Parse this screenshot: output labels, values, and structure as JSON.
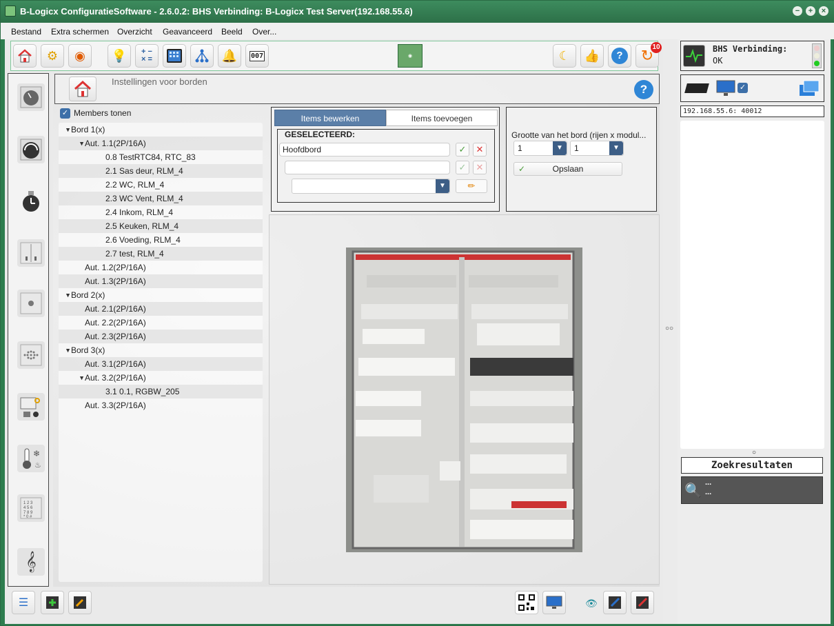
{
  "window": {
    "title": "B-Logicx ConfiguratieSoftware - 2.6.0.2: BHS Verbinding: B-Logicx Test Server(192.168.55.6)",
    "controls": [
      "−",
      "+",
      "×"
    ]
  },
  "menu": [
    "Bestand",
    "Extra schermen",
    "Overzicht",
    "Geavanceerd",
    "Beeld",
    "Over..."
  ],
  "toolbar": {
    "left_icons": [
      "home-icon",
      "wrench-icon",
      "gear-person-icon",
      "lightbulb-gear-icon",
      "calculator-icon",
      "tablet-icon",
      "network-icon",
      "bell-icon",
      "counter-icon"
    ],
    "logo_alt": "logo",
    "right_icons": [
      "moon-icon",
      "thumbs-up-icon",
      "help-icon",
      "refresh-icon"
    ],
    "notification_count": "10"
  },
  "left_rail": [
    "thermostat-icon",
    "gauge-icon",
    "clock-icon",
    "switch-icon",
    "button-icon",
    "speaker-icon",
    "sensor-icon",
    "thermometer-icon",
    "keypad-icon",
    "music-icon"
  ],
  "header": {
    "title": "Instellingen voor borden",
    "help": "?"
  },
  "members_toggle": {
    "label": "Members tonen",
    "checked": true
  },
  "tree": [
    {
      "label": "Bord 1(x)",
      "level": 0,
      "toggle": "▲"
    },
    {
      "label": "Aut. 1.1(2P/16A)",
      "level": 1,
      "toggle": "▲"
    },
    {
      "label": "0.8 TestRTC84, RTC_83",
      "level": 2,
      "toggle": ""
    },
    {
      "label": "2.1 Sas deur, RLM_4",
      "level": 2,
      "toggle": ""
    },
    {
      "label": "2.2 WC, RLM_4",
      "level": 2,
      "toggle": ""
    },
    {
      "label": "2.3 WC Vent, RLM_4",
      "level": 2,
      "toggle": ""
    },
    {
      "label": "2.4 Inkom, RLM_4",
      "level": 2,
      "toggle": ""
    },
    {
      "label": "2.5 Keuken, RLM_4",
      "level": 2,
      "toggle": ""
    },
    {
      "label": "2.6 Voeding, RLM_4",
      "level": 2,
      "toggle": ""
    },
    {
      "label": "2.7 test, RLM_4",
      "level": 2,
      "toggle": ""
    },
    {
      "label": "Aut. 1.2(2P/16A)",
      "level": 1,
      "toggle": ""
    },
    {
      "label": "Aut. 1.3(2P/16A)",
      "level": 1,
      "toggle": ""
    },
    {
      "label": "Bord 2(x)",
      "level": 0,
      "toggle": "▲"
    },
    {
      "label": "Aut. 2.1(2P/16A)",
      "level": 1,
      "toggle": ""
    },
    {
      "label": "Aut. 2.2(2P/16A)",
      "level": 1,
      "toggle": ""
    },
    {
      "label": "Aut. 2.3(2P/16A)",
      "level": 1,
      "toggle": ""
    },
    {
      "label": "Bord 3(x)",
      "level": 0,
      "toggle": "▲"
    },
    {
      "label": "Aut. 3.1(2P/16A)",
      "level": 1,
      "toggle": ""
    },
    {
      "label": "Aut. 3.2(2P/16A)",
      "level": 1,
      "toggle": "▲"
    },
    {
      "label": "3.1 0.1, RGBW_205",
      "level": 2,
      "toggle": ""
    },
    {
      "label": "Aut. 3.3(2P/16A)",
      "level": 1,
      "toggle": ""
    }
  ],
  "editor": {
    "tab_edit": "Items bewerken",
    "tab_add": "Items toevoegen",
    "selected_label": "GESELECTEERD:",
    "name_value": "Hoofdbord",
    "second_value": "",
    "combo_value": "",
    "check": "✓",
    "cross": "✕"
  },
  "size_panel": {
    "label": "Grootte van het bord (rijen x modul...",
    "rows": "1",
    "modules": "1",
    "save": "Opslaan"
  },
  "bottom_icons": [
    "checklist-icon",
    "add-chip-icon",
    "edit-chip-icon",
    "qr-code-icon",
    "monitor-icon",
    "eye-icon",
    "chip-edit-blue-icon",
    "chip-edit-red-icon"
  ],
  "right_panel": {
    "connection_title": "BHS Verbinding:",
    "connection_status": "OK",
    "ip": "192.168.55.6: 40012",
    "search_title": "Zoekresultaten",
    "search_line1": "...",
    "search_line2": "..."
  },
  "colors": {
    "titlebar": "#2e7d4f",
    "accent_blue": "#3d6fa8",
    "help_blue": "#2f86d6",
    "badge_red": "#e02020"
  }
}
